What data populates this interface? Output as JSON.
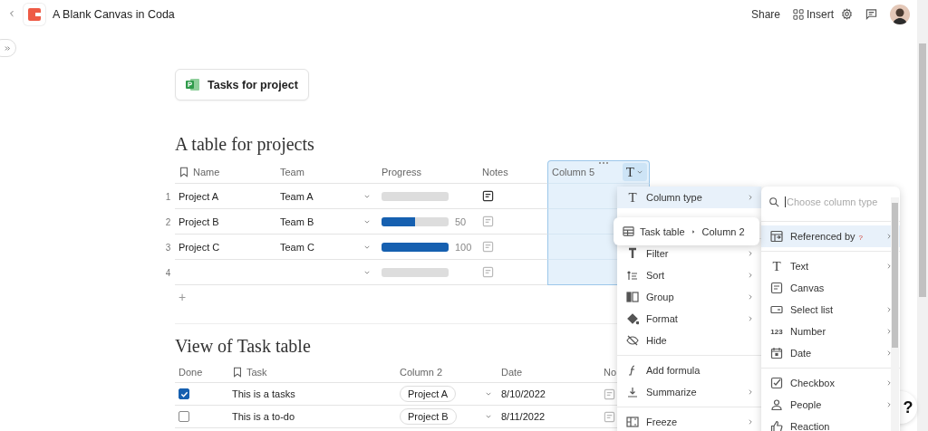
{
  "header": {
    "title": "A Blank Canvas in Coda",
    "share": "Share",
    "insert": "Insert"
  },
  "doc_button": {
    "label": "Tasks for project"
  },
  "table1": {
    "title": "A table for projects",
    "columns": [
      "Name",
      "Team",
      "Progress",
      "Notes",
      "Column 5"
    ],
    "type_button": {
      "glyph": "T"
    },
    "rows": [
      {
        "number": "1",
        "name": "Project A",
        "team": "Team A",
        "level": 0,
        "notes_active": true
      },
      {
        "number": "2",
        "name": "Project B",
        "team": "Team B",
        "level": 0.5,
        "reading": "50",
        "notes_active": false
      },
      {
        "number": "3",
        "name": "Project C",
        "team": "Team C",
        "level": 1,
        "reading": "100",
        "notes_active": false
      },
      {
        "number": "4",
        "level": 0,
        "notes_active": false
      }
    ],
    "add_row": "+"
  },
  "table2": {
    "title": "View of Task table",
    "columns": [
      "Done",
      "Task",
      "Column 2",
      "Date",
      "No"
    ],
    "rows": [
      {
        "done": true,
        "task": "This is a tasks",
        "column_2": "Project A",
        "date": "8/10/2022"
      },
      {
        "done": false,
        "task": "This is a to-do",
        "column_2": "Project B",
        "date": "8/11/2022"
      }
    ]
  },
  "column_menu": {
    "sections": [
      [
        {
          "label": "Column type",
          "glyph": "T",
          "submenu": true,
          "selected": true
        }
      ],
      [
        {
          "label": "Filter",
          "submenu": true,
          "selected": false
        },
        {
          "label": "Sort",
          "submenu": true,
          "selected": false
        },
        {
          "label": "Group",
          "submenu": true,
          "selected": false
        },
        {
          "label": "Format",
          "submenu": true,
          "selected": false
        },
        {
          "label": "Hide",
          "submenu": false,
          "selected": false
        }
      ],
      [
        {
          "label": "Add formula",
          "submenu": false,
          "selected": false
        },
        {
          "label": "Summarize",
          "submenu": true,
          "selected": false
        }
      ],
      [
        {
          "label": "Freeze",
          "submenu": true,
          "selected": false
        }
      ]
    ]
  },
  "reference_popup": {
    "table": "Task table",
    "column": "Column 2"
  },
  "type_menu": {
    "search": {
      "placeholder": "Choose column type"
    },
    "sections": [
      [
        {
          "label": "Referenced by",
          "help": "?",
          "submenu": true,
          "selected": true
        }
      ],
      [
        {
          "label": "Text",
          "glyph": "T",
          "submenu": true,
          "selected": false
        },
        {
          "label": "Canvas",
          "submenu": false,
          "selected": false
        },
        {
          "label": "Select list",
          "submenu": true,
          "selected": false
        },
        {
          "label": "Number",
          "glyph": "123",
          "submenu": true,
          "selected": false
        },
        {
          "label": "Date",
          "submenu": true,
          "selected": false
        }
      ],
      [
        {
          "label": "Checkbox",
          "submenu": true,
          "selected": false
        },
        {
          "label": "People",
          "submenu": true,
          "selected": false
        },
        {
          "label": "Reaction",
          "submenu": false,
          "selected": false
        }
      ]
    ]
  },
  "help_button": "?"
}
